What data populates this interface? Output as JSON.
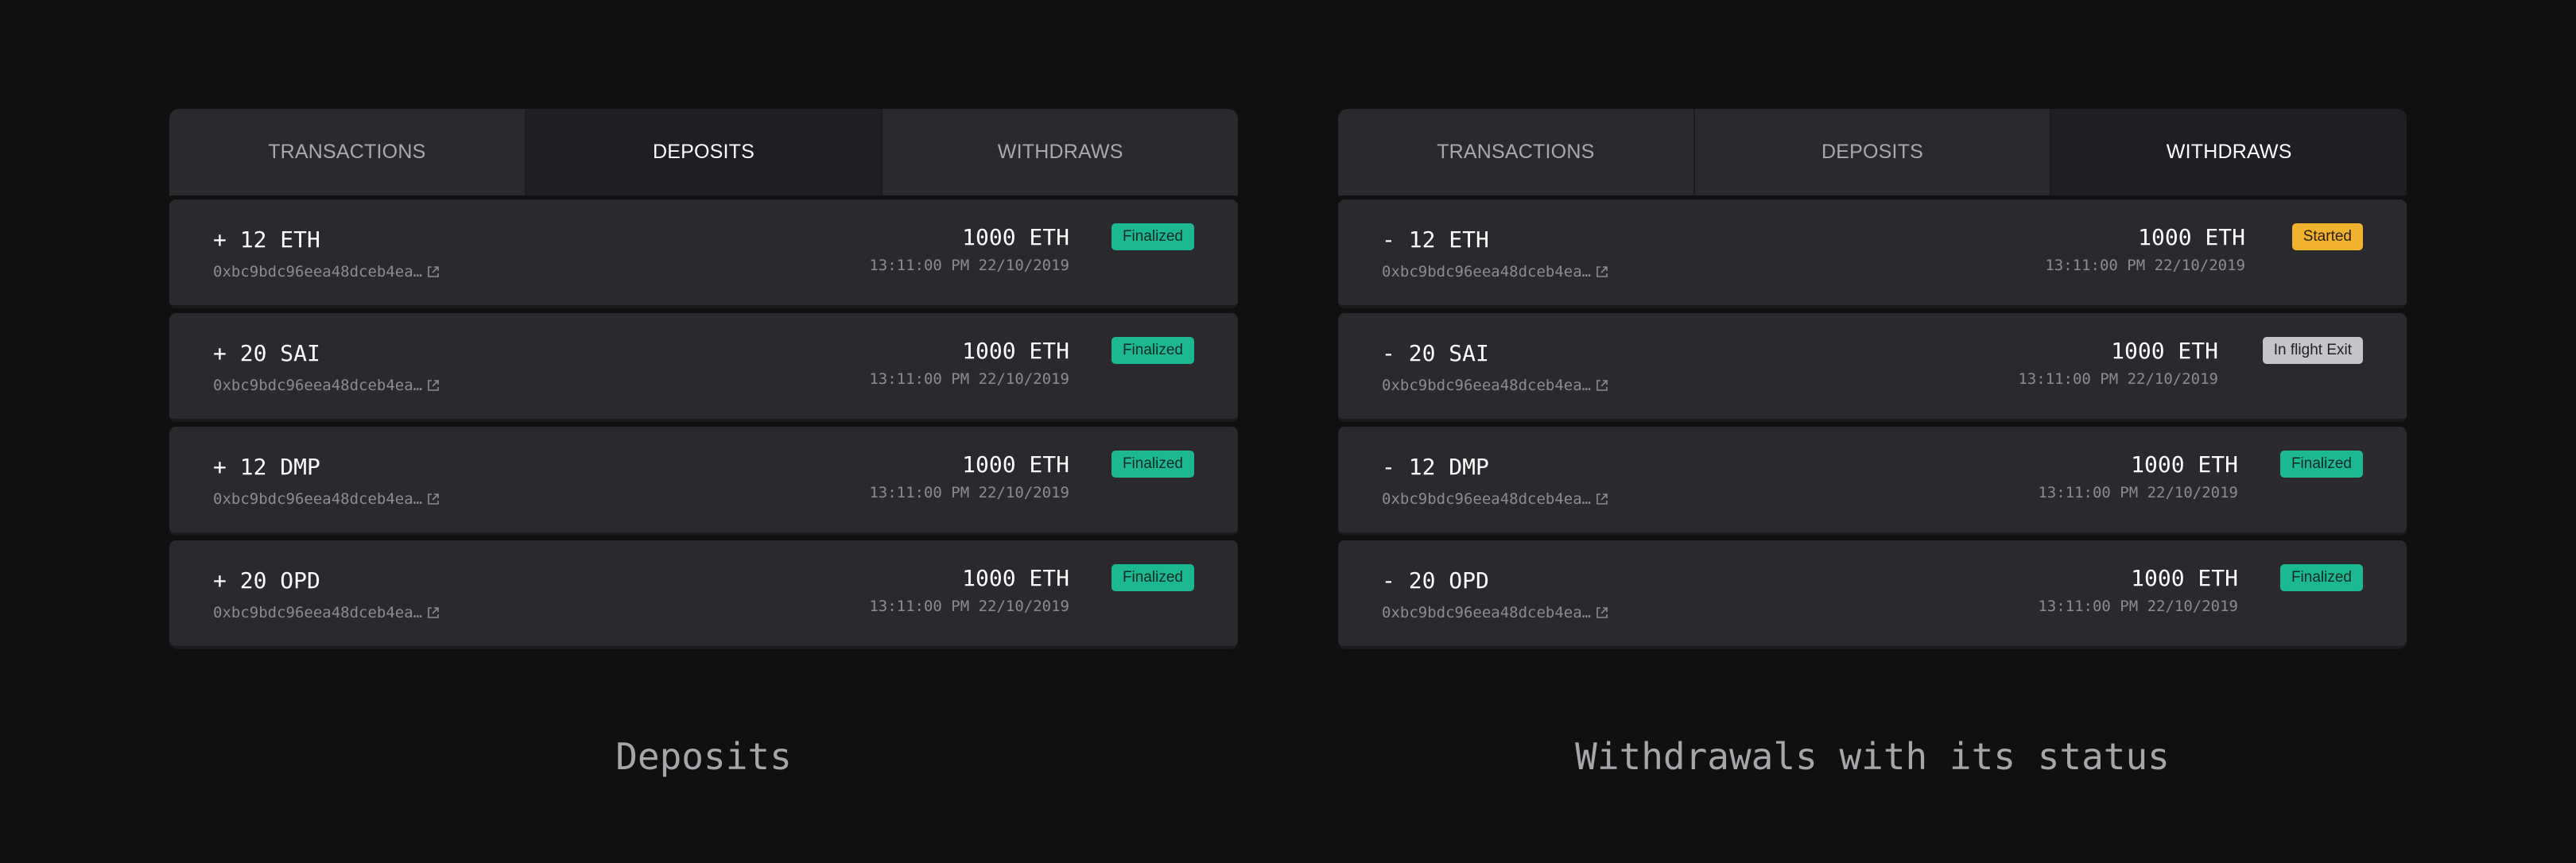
{
  "deposits_panel": {
    "tabs": [
      "TRANSACTIONS",
      "DEPOSITS",
      "WITHDRAWS"
    ],
    "active_tab": 1,
    "rows": [
      {
        "amount": "+ 12 ETH",
        "hash": "0xbc9bdc96eea48dceb4ea…",
        "value": "1000 ETH",
        "time": "13:11:00 PM 22/10/2019",
        "status": "Finalized",
        "status_kind": "finalized"
      },
      {
        "amount": "+ 20 SAI",
        "hash": "0xbc9bdc96eea48dceb4ea…",
        "value": "1000 ETH",
        "time": "13:11:00 PM 22/10/2019",
        "status": "Finalized",
        "status_kind": "finalized"
      },
      {
        "amount": "+ 12 DMP",
        "hash": "0xbc9bdc96eea48dceb4ea…",
        "value": "1000 ETH",
        "time": "13:11:00 PM 22/10/2019",
        "status": "Finalized",
        "status_kind": "finalized"
      },
      {
        "amount": "+ 20 OPD",
        "hash": "0xbc9bdc96eea48dceb4ea…",
        "value": "1000 ETH",
        "time": "13:11:00 PM 22/10/2019",
        "status": "Finalized",
        "status_kind": "finalized"
      }
    ],
    "caption": "Deposits"
  },
  "withdrawals_panel": {
    "tabs": [
      "TRANSACTIONS",
      "DEPOSITS",
      "WITHDRAWS"
    ],
    "active_tab": 2,
    "rows": [
      {
        "amount": "- 12 ETH",
        "hash": "0xbc9bdc96eea48dceb4ea…",
        "value": "1000 ETH",
        "time": "13:11:00 PM 22/10/2019",
        "status": "Started",
        "status_kind": "started"
      },
      {
        "amount": "- 20 SAI",
        "hash": "0xbc9bdc96eea48dceb4ea…",
        "value": "1000 ETH",
        "time": "13:11:00 PM 22/10/2019",
        "status": "In flight Exit",
        "status_kind": "inflight"
      },
      {
        "amount": "- 12 DMP",
        "hash": "0xbc9bdc96eea48dceb4ea…",
        "value": "1000 ETH",
        "time": "13:11:00 PM 22/10/2019",
        "status": "Finalized",
        "status_kind": "finalized"
      },
      {
        "amount": "- 20 OPD",
        "hash": "0xbc9bdc96eea48dceb4ea…",
        "value": "1000 ETH",
        "time": "13:11:00 PM 22/10/2019",
        "status": "Finalized",
        "status_kind": "finalized"
      }
    ],
    "caption": "Withdrawals with its status"
  },
  "icons": {
    "hash_link": "external-link-icon"
  },
  "colors": {
    "background": "#101011",
    "panel": "#29292e",
    "active_tab": "#1f1f23",
    "finalized": "#1cb892",
    "started": "#f1b22e",
    "inflight": "#c4c4c9"
  }
}
